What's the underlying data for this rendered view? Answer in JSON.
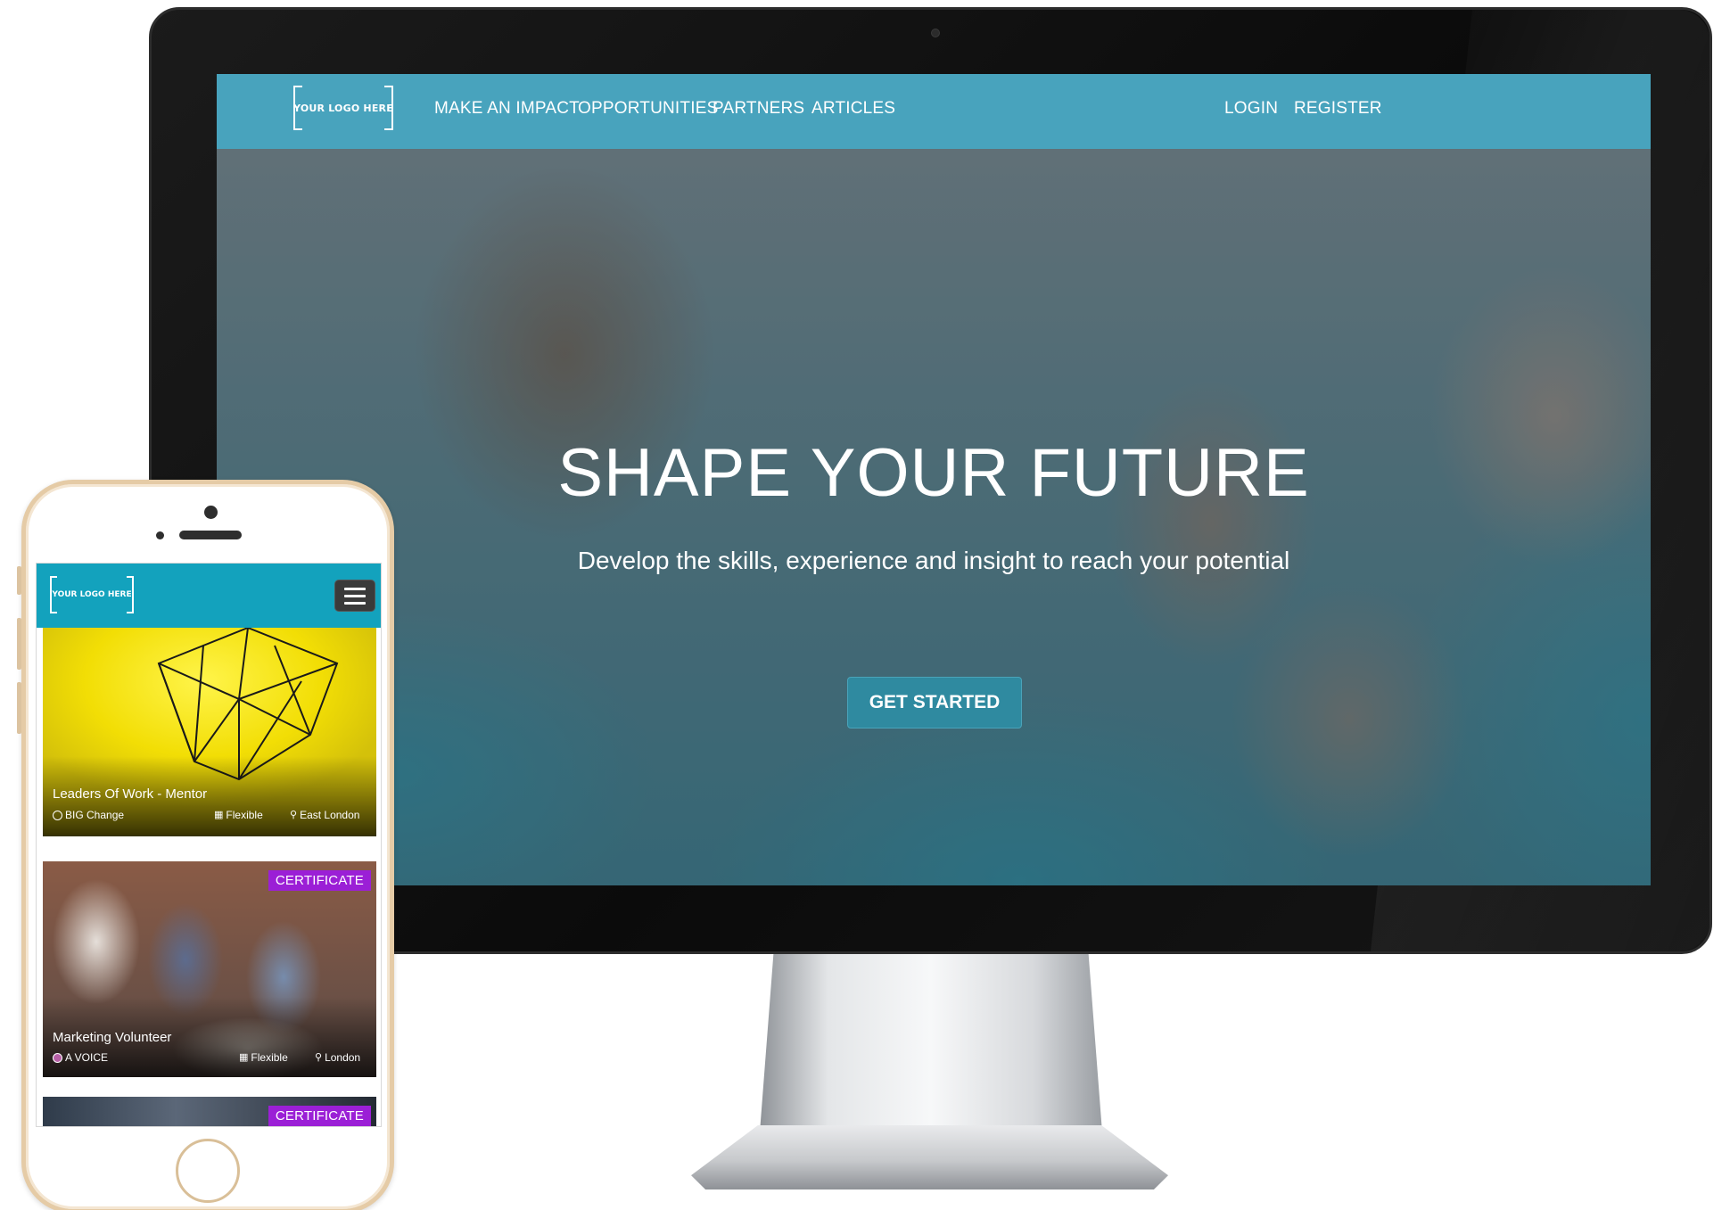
{
  "desktop": {
    "logo_text": "YOUR LOGO HERE",
    "nav_left": [
      "MAKE AN IMPACT",
      "OPPORTUNITIES",
      "PARTNERS",
      "ARTICLES"
    ],
    "nav_right": [
      "LOGIN",
      "REGISTER"
    ],
    "hero": {
      "title": "SHAPE YOUR FUTURE",
      "subtitle": "Develop the skills, experience and insight to reach your potential",
      "cta": "GET STARTED"
    },
    "colors": {
      "navbar": "#48a3bd",
      "cta": "#2f8aa0"
    }
  },
  "mobile": {
    "logo_text": "YOUR LOGO HERE",
    "menu_icon": "hamburger-icon",
    "cards": [
      {
        "title": "Leaders Of Work - Mentor",
        "org": "BIG Change",
        "schedule": "Flexible",
        "location": "East London",
        "badge": ""
      },
      {
        "title": "Marketing Volunteer",
        "org": "A VOICE",
        "schedule": "Flexible",
        "location": "London",
        "badge": "CERTIFICATE"
      },
      {
        "badge": "CERTIFICATE"
      }
    ],
    "colors": {
      "navbar": "#13a2bd",
      "badge": "#9b1fd6"
    }
  }
}
